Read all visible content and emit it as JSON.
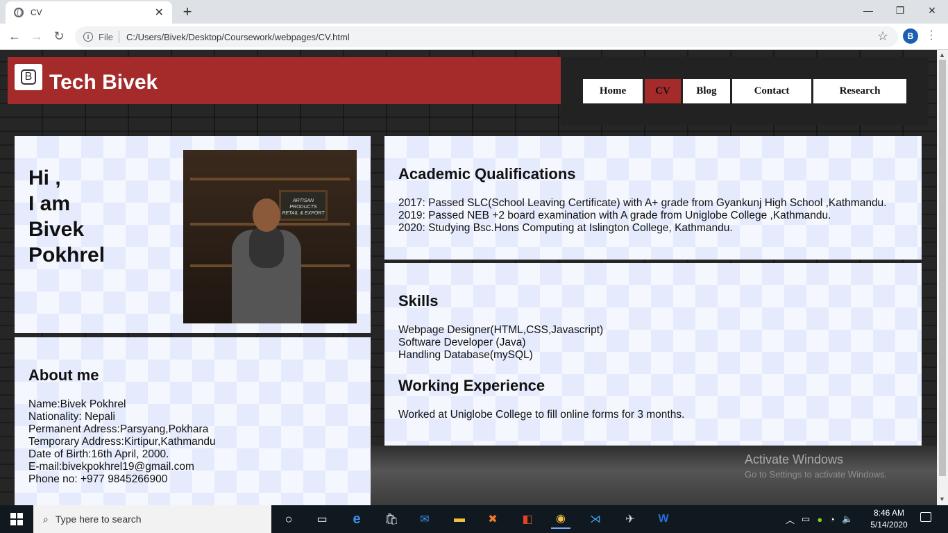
{
  "browser": {
    "tab_title": "CV",
    "file_label": "File",
    "url": "C:/Users/Bivek/Desktop/Coursework/webpages/CV.html",
    "profile_initial": "B"
  },
  "site": {
    "logo_letter": "B",
    "title": "Tech Bivek",
    "nav": [
      "Home",
      "CV",
      "Blog",
      "Contact",
      "Research"
    ],
    "active_nav": "CV"
  },
  "hero": {
    "lines": [
      "Hi ,",
      "I am",
      "Bivek",
      "Pokhrel"
    ],
    "photo_sign": "ARTISAN PRODUCTS RETAIL & EXPORT"
  },
  "about": {
    "title": "About me",
    "lines": [
      "Name:Bivek Pokhrel",
      "Nationality: Nepali",
      "Permanent Adress:Parsyang,Pokhara",
      "Temporary Address:Kirtipur,Kathmandu",
      "Date of Birth:16th April, 2000.",
      "E-mail:bivekpokhrel19@gmail.com",
      "Phone no: +977 9845266900"
    ]
  },
  "academic": {
    "title": "Academic Qualifications",
    "lines": [
      "2017: Passed SLC(School Leaving Certificate) with A+ grade from Gyankunj High School ,Kathmandu.",
      "2019: Passed NEB +2 board examination with A grade from Uniglobe College ,Kathmandu.",
      "2020: Studying Bsc.Hons Computing at Islington College, Kathmandu."
    ]
  },
  "skills": {
    "title": "Skills",
    "lines": [
      "Webpage Designer(HTML,CSS,Javascript)",
      "Software Developer (Java)",
      "Handling Database(mySQL)"
    ]
  },
  "work": {
    "title": "Working Experience",
    "lines": [
      "Worked at Uniglobe College to fill online forms for 3 months."
    ]
  },
  "watermark": {
    "title": "Activate Windows",
    "subtitle": "Go to Settings to activate Windows."
  },
  "taskbar": {
    "search_placeholder": "Type here to search",
    "time": "8:46 AM",
    "date": "5/14/2020"
  },
  "colors": {
    "accent": "#a52a2a",
    "panel": "#f5f7ff"
  }
}
